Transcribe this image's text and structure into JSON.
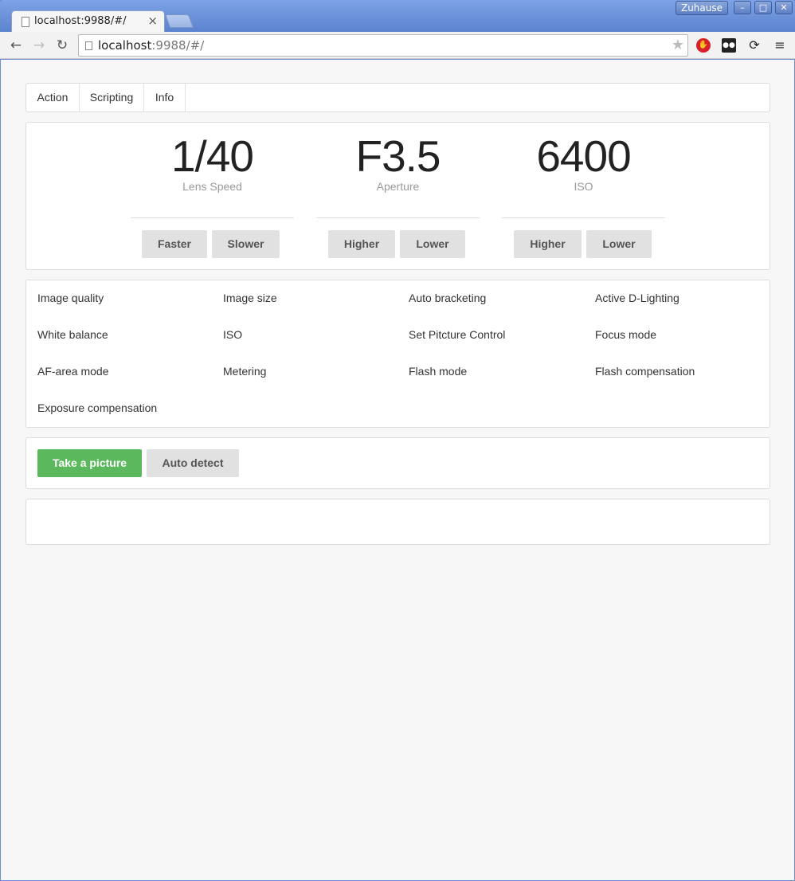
{
  "browser": {
    "tab_title": "localhost:9988/#/",
    "url_host": "localhost",
    "url_rest": ":9988/#/",
    "profile_name": "Zuhause",
    "icons": {
      "tab_close": "×",
      "back": "←",
      "forward": "→",
      "reload": "↻",
      "star": "★",
      "menu": "≡",
      "minimize": "–",
      "maximize": "□",
      "close": "✕"
    }
  },
  "nav": {
    "items": [
      "Action",
      "Scripting",
      "Info"
    ]
  },
  "camera": {
    "lens_speed": {
      "value": "1/40",
      "label": "Lens Speed",
      "btn_up": "Faster",
      "btn_down": "Slower"
    },
    "aperture": {
      "value": "F3.5",
      "label": "Aperture",
      "btn_up": "Higher",
      "btn_down": "Lower"
    },
    "iso": {
      "value": "6400",
      "label": "ISO",
      "btn_up": "Higher",
      "btn_down": "Lower"
    }
  },
  "menu_items": [
    "Image quality",
    "Image size",
    "Auto bracketing",
    "Active D-Lighting",
    "White balance",
    "ISO",
    "Set Pitcture Control",
    "Focus mode",
    "AF-area mode",
    "Metering",
    "Flash mode",
    "Flash compensation",
    "Exposure compensation"
  ],
  "actions": {
    "take_picture": "Take a picture",
    "auto_detect": "Auto detect"
  },
  "colors": {
    "primary_button": "#5cb85c",
    "default_button": "#e1e1e1"
  }
}
